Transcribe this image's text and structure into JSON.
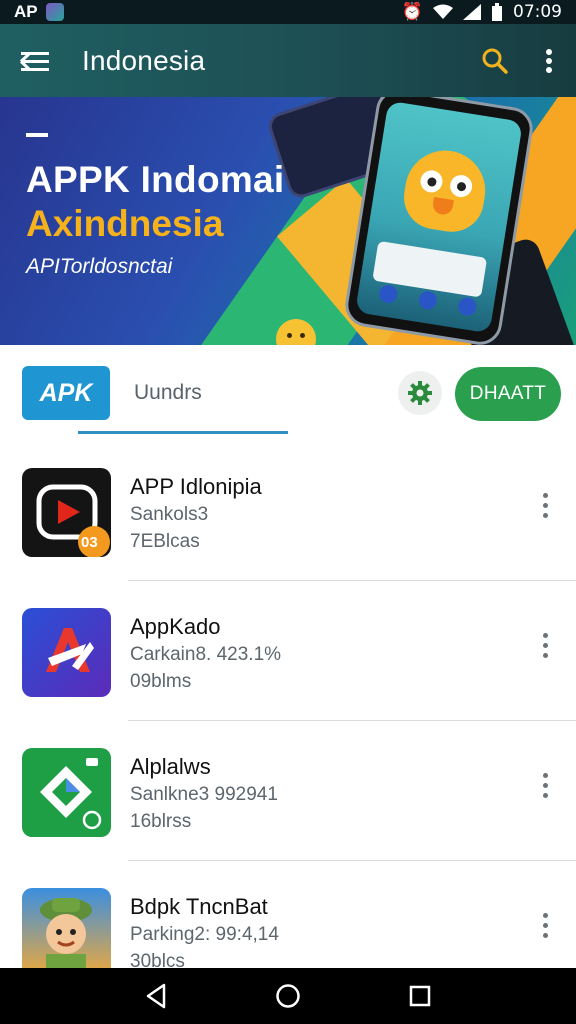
{
  "status_bar": {
    "carrier": "AP",
    "time": "07:09"
  },
  "app_bar": {
    "title": "Indonesia",
    "icons": [
      "menu-icon",
      "search-icon",
      "more-vert-icon"
    ]
  },
  "banner": {
    "title": "APPK Indomai",
    "subtitle": "Axindnesia",
    "tagline": "APITorldosnctai"
  },
  "tabs": {
    "apk_chip": "APK",
    "tab_label": "Uundrs",
    "primary_button": "DHAATT"
  },
  "apps": [
    {
      "name": "APP Idlonipia",
      "meta": "Sankols3",
      "count": "7EBlcas",
      "badge": "03"
    },
    {
      "name": "AppKado",
      "meta": "Carkain8. 423.1%",
      "count": "09blms",
      "badge": ""
    },
    {
      "name": "Alplalws",
      "meta": "Sanlkne3 992941",
      "count": "16blrss",
      "badge": ""
    },
    {
      "name": "Bdpk TncnBat",
      "meta": "Parking2: 99:4,14",
      "count": "30blcs",
      "badge": ""
    }
  ],
  "colors": {
    "app_bar": "#1f5f62",
    "accent_blue": "#1f96d2",
    "primary_green": "#2aa04e",
    "search_icon": "#f0b21e"
  }
}
